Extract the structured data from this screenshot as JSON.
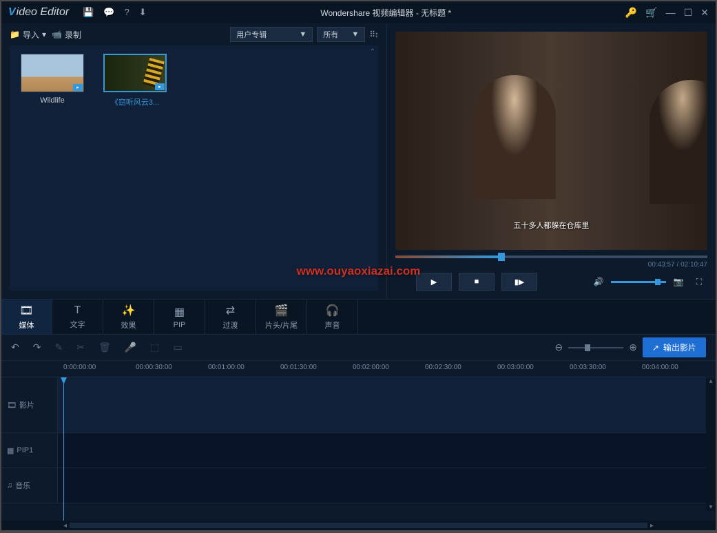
{
  "titlebar": {
    "logo_v": "V",
    "logo_rest": "ideo Editor",
    "title": "Wondershare 视频编辑器 - 无标题 *"
  },
  "media": {
    "import_label": "导入",
    "record_label": "录制",
    "dropdown_user": "用户专辑",
    "dropdown_all": "所有",
    "items": [
      {
        "label": "Wildlife"
      },
      {
        "label": "《窃听风云3..."
      }
    ]
  },
  "preview": {
    "subtitle": "五十多人都躲在仓库里",
    "time_current": "00:43:57",
    "time_total": "02:10:47"
  },
  "tabs": [
    {
      "label": "媒体",
      "icon": "🎞"
    },
    {
      "label": "文字",
      "icon": "T"
    },
    {
      "label": "效果",
      "icon": "✨"
    },
    {
      "label": "PIP",
      "icon": "▦"
    },
    {
      "label": "过渡",
      "icon": "⇄"
    },
    {
      "label": "片头/片尾",
      "icon": "🎬"
    },
    {
      "label": "声音",
      "icon": "🎧"
    }
  ],
  "toolbar2": {
    "export_label": "输出影片"
  },
  "timeline": {
    "ticks": [
      "0:00:00:00",
      "00:00:30:00",
      "00:01:00:00",
      "00:01:30:00",
      "00:02:00:00",
      "00:02:30:00",
      "00:03:00:00",
      "00:03:30:00",
      "00:04:00:00"
    ],
    "tracks": [
      {
        "icon": "🎞",
        "label": "影片"
      },
      {
        "icon": "▦",
        "label": "PIP1"
      },
      {
        "icon": "♫",
        "label": "音乐"
      }
    ]
  },
  "watermark": "www.ouyaoxiazai.com"
}
